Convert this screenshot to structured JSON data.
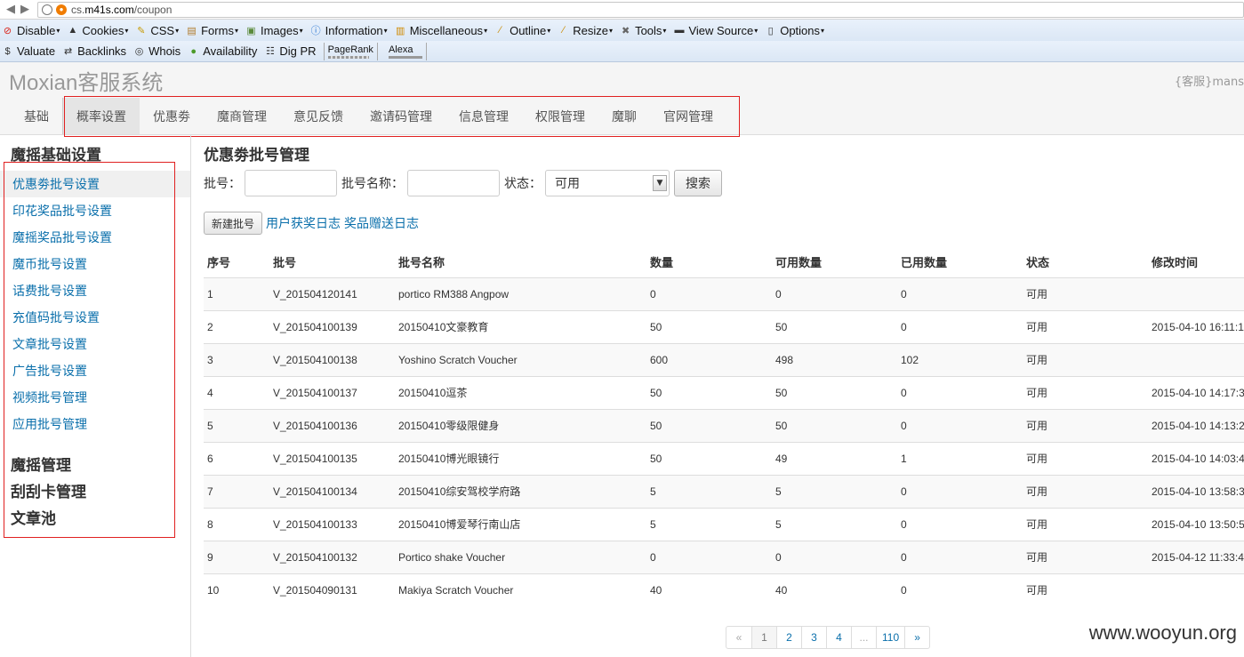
{
  "browser": {
    "url_prefix": "cs.",
    "url_host": "m41s.com",
    "url_path": "/coupon",
    "toolbar1": [
      {
        "label": "Disable",
        "icon": "no-icon",
        "color": "#d9261c"
      },
      {
        "label": "Cookies",
        "icon": "person-icon",
        "color": "#333333"
      },
      {
        "label": "CSS",
        "icon": "pencil-icon",
        "color": "#c79a00"
      },
      {
        "label": "Forms",
        "icon": "clipboard-icon",
        "color": "#b07a2a"
      },
      {
        "label": "Images",
        "icon": "image-icon",
        "color": "#5a8a3a"
      },
      {
        "label": "Information",
        "icon": "info-icon",
        "color": "#1f6fd1"
      },
      {
        "label": "Miscellaneous",
        "icon": "notebook-icon",
        "color": "#d08a00"
      },
      {
        "label": "Outline",
        "icon": "pen-icon",
        "color": "#c98a00"
      },
      {
        "label": "Resize",
        "icon": "ruler-icon",
        "color": "#c98a00"
      },
      {
        "label": "Tools",
        "icon": "wrench-icon",
        "color": "#666666"
      },
      {
        "label": "View Source",
        "icon": "terminal-icon",
        "color": "#333333"
      },
      {
        "label": "Options",
        "icon": "list-icon",
        "color": "#333333"
      }
    ],
    "toolbar2": [
      {
        "label": "Valuate",
        "icon": "dollar-icon"
      },
      {
        "label": "Backlinks",
        "icon": "swap-icon"
      },
      {
        "label": "Whois",
        "icon": "globe-icon"
      },
      {
        "label": "Availability",
        "icon": "search-icon"
      },
      {
        "label": "Dig PR",
        "icon": "network-icon"
      }
    ],
    "pagerank_label": "PageRank",
    "alexa_label": "Alexa"
  },
  "app": {
    "title": "Moxian客服系统",
    "user": "{客服}mans"
  },
  "topnav": {
    "items": [
      "基础",
      "概率设置",
      "优惠劵",
      "魔商管理",
      "意见反馈",
      "邀请码管理",
      "信息管理",
      "权限管理",
      "魔聊",
      "官网管理"
    ],
    "active_index": 1
  },
  "sidebar": {
    "title": "魔摇基础设置",
    "links": [
      "优惠劵批号设置",
      "印花奖品批号设置",
      "魔摇奖品批号设置",
      "魔币批号设置",
      "话费批号设置",
      "充值码批号设置",
      "文章批号设置",
      "广告批号设置",
      "视频批号管理",
      "应用批号管理"
    ],
    "sections": [
      "魔摇管理",
      "刮刮卡管理",
      "文章池"
    ]
  },
  "main": {
    "heading": "优惠劵批号管理",
    "filter_batch_label": "批号：",
    "filter_name_label": "批号名称：",
    "filter_status_label": "状态：",
    "status_value": "可用",
    "search_button": "搜索",
    "new_button": "新建批号",
    "link_user_log": "用户获奖日志",
    "link_gift_log": "奖品赠送日志"
  },
  "table": {
    "headers": [
      "序号",
      "批号",
      "批号名称",
      "数量",
      "可用数量",
      "已用数量",
      "状态",
      "修改时间"
    ],
    "rows": [
      [
        "1",
        "V_201504120141",
        "portico RM388 Angpow",
        "0",
        "0",
        "0",
        "可用",
        ""
      ],
      [
        "2",
        "V_201504100139",
        "20150410文豪教育",
        "50",
        "50",
        "0",
        "可用",
        "2015-04-10 16:11:1"
      ],
      [
        "3",
        "V_201504100138",
        "Yoshino Scratch Voucher",
        "600",
        "498",
        "102",
        "可用",
        ""
      ],
      [
        "4",
        "V_201504100137",
        "20150410逗茶",
        "50",
        "50",
        "0",
        "可用",
        "2015-04-10 14:17:3"
      ],
      [
        "5",
        "V_201504100136",
        "20150410零级限健身",
        "50",
        "50",
        "0",
        "可用",
        "2015-04-10 14:13:2"
      ],
      [
        "6",
        "V_201504100135",
        "20150410博光眼镜行",
        "50",
        "49",
        "1",
        "可用",
        "2015-04-10 14:03:4"
      ],
      [
        "7",
        "V_201504100134",
        "20150410综安驾校学府路",
        "5",
        "5",
        "0",
        "可用",
        "2015-04-10 13:58:3"
      ],
      [
        "8",
        "V_201504100133",
        "20150410博爱琴行南山店",
        "5",
        "5",
        "0",
        "可用",
        "2015-04-10 13:50:5"
      ],
      [
        "9",
        "V_201504100132",
        "Portico shake Voucher",
        "0",
        "0",
        "0",
        "可用",
        "2015-04-12 11:33:4"
      ],
      [
        "10",
        "V_201504090131",
        "Makiya Scratch Voucher",
        "40",
        "40",
        "0",
        "可用",
        ""
      ]
    ]
  },
  "pager": {
    "prev": "«",
    "pages": [
      "1",
      "2",
      "3",
      "4",
      "...",
      "110"
    ],
    "next": "»",
    "current": "1"
  },
  "watermark": "www.wooyun.org",
  "colors": {
    "link": "#0a6fab",
    "highlight_box": "#e02020"
  }
}
